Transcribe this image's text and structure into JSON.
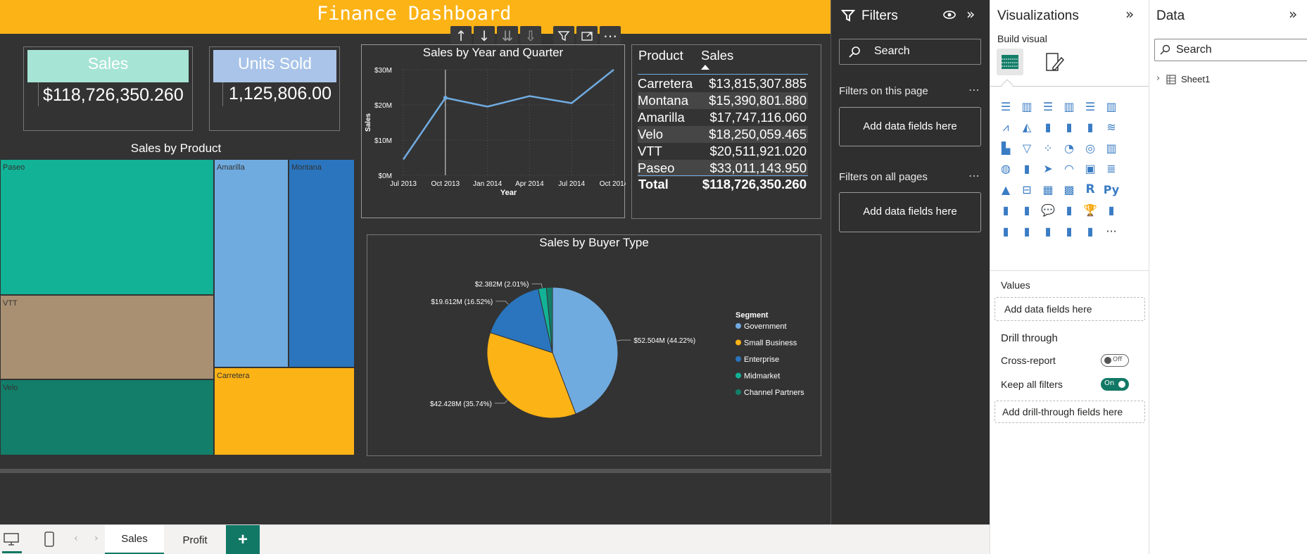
{
  "dashboard": {
    "title": "Finance Dashboard",
    "cards": {
      "sales": {
        "title": "Sales",
        "value": "$118,726,350.260"
      },
      "units": {
        "title": "Units Sold",
        "value": "1,125,806.00"
      }
    },
    "treemap": {
      "title": "Sales by Product",
      "cells": [
        {
          "label": "Paseo",
          "color": "#12b296"
        },
        {
          "label": "VTT",
          "color": "#a99073"
        },
        {
          "label": "Velo",
          "color": "#137e6a"
        },
        {
          "label": "Amarilla",
          "color": "#70abe0"
        },
        {
          "label": "Montana",
          "color": "#2a75bd"
        },
        {
          "label": "Carretera",
          "color": "#fcb316"
        }
      ]
    },
    "line_chart": {
      "title": "Sales by Year and Quarter",
      "ylabel": "Sales",
      "xlabel": "Year",
      "yticks": [
        "$30M",
        "$20M",
        "$10M",
        "$0M"
      ],
      "xticks": [
        "Jul 2013",
        "Oct 2013",
        "Jan 2014",
        "Apr 2014",
        "Jul 2014",
        "Oct 2014"
      ]
    },
    "table": {
      "headers": [
        "Product",
        "Sales"
      ],
      "rows": [
        [
          "Carretera",
          "$13,815,307.885"
        ],
        [
          "Montana",
          "$15,390,801.880"
        ],
        [
          "Amarilla",
          "$17,747,116.060"
        ],
        [
          "Velo",
          "$18,250,059.465"
        ],
        [
          "VTT",
          "$20,511,921.020"
        ],
        [
          "Paseo",
          "$33,011,143.950"
        ]
      ],
      "total_label": "Total",
      "total_value": "$118,726,350.260"
    },
    "pie": {
      "title": "Sales by Buyer Type",
      "legend_title": "Segment",
      "labels": [
        "$52.504M (44.22%)",
        "$42.428M (35.74%)",
        "$19.612M (16.52%)",
        "$2.382M (2.01%)"
      ],
      "segments": [
        {
          "name": "Government",
          "color": "#70abe0"
        },
        {
          "name": "Small Business",
          "color": "#fcb316"
        },
        {
          "name": "Enterprise",
          "color": "#2a75bd"
        },
        {
          "name": "Midmarket",
          "color": "#12b296"
        },
        {
          "name": "Channel Partners",
          "color": "#137e6a"
        }
      ]
    }
  },
  "chart_data": [
    {
      "type": "line",
      "title": "Sales by Year and Quarter",
      "xlabel": "Year",
      "ylabel": "Sales",
      "x": [
        "2013 Q3",
        "2013 Q4",
        "2014 Q1",
        "2014 Q2",
        "2014 Q3",
        "2014 Q4"
      ],
      "values": [
        4.5,
        22,
        19.5,
        22.5,
        20.5,
        30
      ],
      "ylim": [
        0,
        30
      ],
      "color": "#70abe0"
    },
    {
      "type": "pie",
      "title": "Sales by Buyer Type",
      "categories": [
        "Government",
        "Small Business",
        "Enterprise",
        "Midmarket",
        "Channel Partners"
      ],
      "values": [
        44.22,
        35.74,
        16.52,
        2.01,
        1.51
      ],
      "legend": "right"
    },
    {
      "type": "table",
      "title": "",
      "columns": [
        "Product",
        "Sales"
      ],
      "rows": [
        [
          "Carretera",
          13815307.885
        ],
        [
          "Montana",
          15390801.88
        ],
        [
          "Amarilla",
          17747116.06
        ],
        [
          "Velo",
          18250059.465
        ],
        [
          "VTT",
          20511921.02
        ],
        [
          "Paseo",
          33011143.95
        ]
      ]
    },
    {
      "type": "heatmap",
      "title": "Sales by Product",
      "categories": [
        "Paseo",
        "VTT",
        "Velo",
        "Amarilla",
        "Montana",
        "Carretera"
      ],
      "values": [
        33011143.95,
        20511921.02,
        18250059.465,
        17747116.06,
        15390801.88,
        13815307.885
      ]
    }
  ],
  "filters": {
    "title": "Filters",
    "search_placeholder": "Search",
    "on_page": "Filters on this page",
    "on_all_pages": "Filters on all pages",
    "add_fields": "Add data fields here"
  },
  "visualizations": {
    "title": "Visualizations",
    "build_visual": "Build visual",
    "values_label": "Values",
    "add_fields": "Add data fields here",
    "drill_through": "Drill through",
    "cross_report": "Cross-report",
    "cross_report_state": "Off",
    "keep_filters": "Keep all filters",
    "keep_filters_state": "On",
    "add_drill": "Add drill-through fields here",
    "r_icon": "R",
    "py_icon": "Py",
    "more": "···"
  },
  "data_pane": {
    "title": "Data",
    "search_placeholder": "Search",
    "tables": [
      "Sheet1"
    ]
  },
  "pages": {
    "tabs": [
      "Sales",
      "Profit"
    ],
    "active": "Sales",
    "add": "+"
  }
}
